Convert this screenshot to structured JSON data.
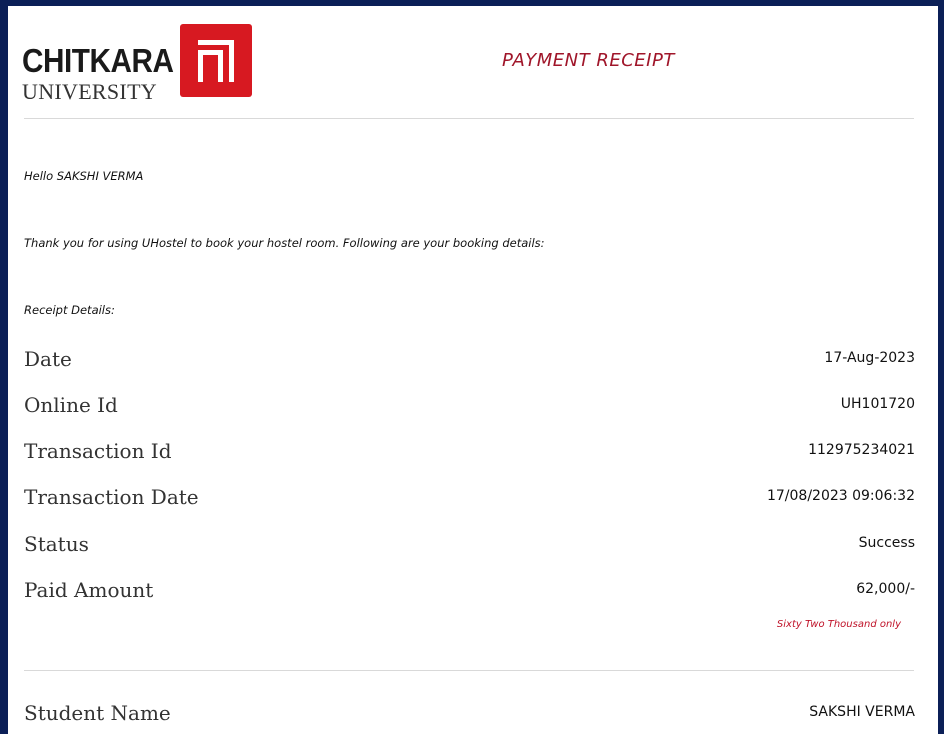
{
  "header": {
    "logo_name": "CHITKARA",
    "logo_sub": "UNIVERSITY",
    "title": "PAYMENT RECEIPT"
  },
  "greeting": "Hello SAKSHI VERMA",
  "intro": "Thank you for using UHostel to book your hostel room. Following are your booking details:",
  "receipt_heading": "Receipt Details:",
  "details": [
    {
      "label": "Date",
      "value": "17-Aug-2023"
    },
    {
      "label": "Online Id",
      "value": "UH101720"
    },
    {
      "label": "Transaction Id",
      "value": "112975234021"
    },
    {
      "label": "Transaction Date",
      "value": "17/08/2023 09:06:32"
    },
    {
      "label": "Status",
      "value": "Success"
    },
    {
      "label": "Paid Amount",
      "value": "62,000/-"
    }
  ],
  "amount_in_words": "Sixty Two Thousand only",
  "student": {
    "label": "Student Name",
    "value": "SAKSHI VERMA"
  },
  "colors": {
    "brand_red": "#d71921",
    "title_red": "#a0162a",
    "frame_navy": "#0b1f57"
  },
  "icons": {
    "logo_mark": "chitkara-logo-icon"
  }
}
